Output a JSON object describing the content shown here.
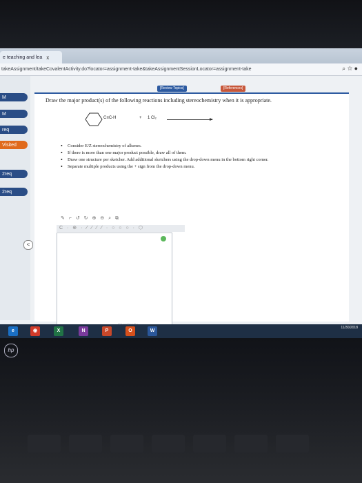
{
  "browser": {
    "tab_title": "e teaching and lea",
    "tab_close": "x",
    "url": "takeAssignment/takeCovalentActivity.do?locator=assignment-take&takeAssignmentSessionLocator=assignment-take"
  },
  "left_nav": {
    "items": [
      "M",
      "M",
      "req",
      "Visited",
      "2req",
      "2req"
    ],
    "collapse_glyph": "<"
  },
  "panel": {
    "review_topics": "[Review Topics]",
    "references": "[References]",
    "question": "Draw the major product(s) of the following reactions including stereochemistry when it is appropriate.",
    "reaction": {
      "alkyne": "C≡C-H",
      "plus": "+",
      "reagent": "1 Cl₂"
    },
    "instructions": [
      "Consider E/Z stereochemistry of alkenes.",
      "If there is more than one major product possible, draw all of them.",
      "Draw one structure per sketcher. Add additional sketchers using the drop-down menu in the bottom right corner.",
      "Separate multiple products using the + sign from the drop-down menu."
    ],
    "toolbar_row1": "✎ ⌐ ↺ ↻ ⊕ ⊖ ⌕ ⧉",
    "toolbar_row2": "C · ⊕ · ⁄ ⁄ ⁄ ⁄ · ○ ○ ○ · ⬡",
    "watermark": "ChemDoodle"
  },
  "taskbar": {
    "apps": [
      "e",
      "◉",
      "X",
      "N",
      "P",
      "O",
      "W"
    ],
    "time": "4:35 PM",
    "date": "11/30/2018"
  },
  "brand": "hp"
}
